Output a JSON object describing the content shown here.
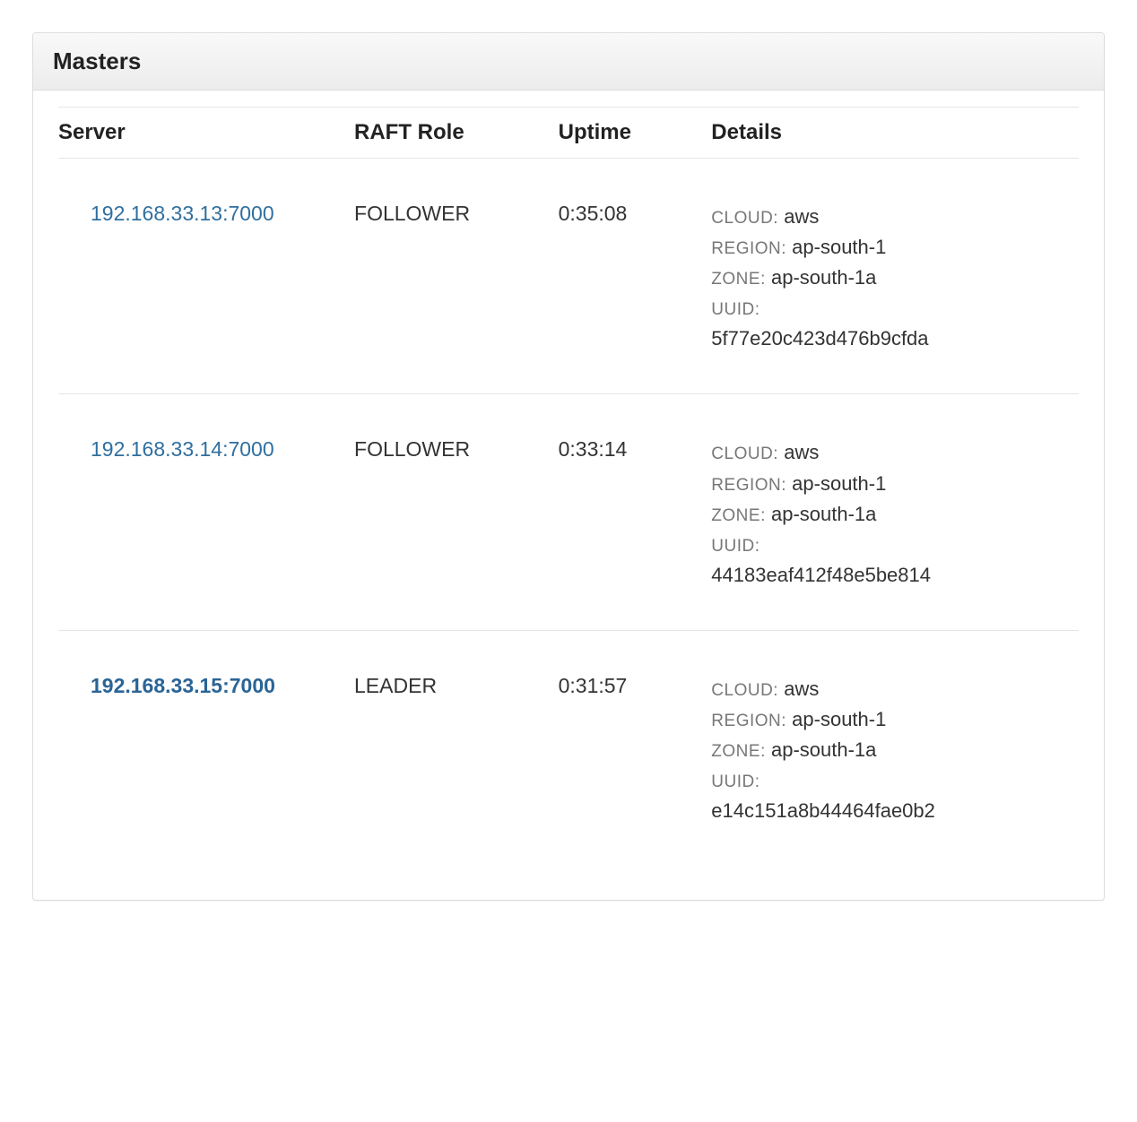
{
  "panel": {
    "title": "Masters"
  },
  "columns": {
    "server": "Server",
    "role": "RAFT Role",
    "uptime": "Uptime",
    "details": "Details"
  },
  "labels": {
    "cloud": "CLOUD:",
    "region": "REGION:",
    "zone": "ZONE:",
    "uuid": "UUID:"
  },
  "rows": [
    {
      "server": "192.168.33.13:7000",
      "role": "FOLLOWER",
      "uptime": "0:35:08",
      "cloud": "aws",
      "region": "ap-south-1",
      "zone": "ap-south-1a",
      "uuid": "5f77e20c423d476b9cfda"
    },
    {
      "server": "192.168.33.14:7000",
      "role": "FOLLOWER",
      "uptime": "0:33:14",
      "cloud": "aws",
      "region": "ap-south-1",
      "zone": "ap-south-1a",
      "uuid": "44183eaf412f48e5be814"
    },
    {
      "server": "192.168.33.15:7000",
      "role": "LEADER",
      "uptime": "0:31:57",
      "cloud": "aws",
      "region": "ap-south-1",
      "zone": "ap-south-1a",
      "uuid": "e14c151a8b44464fae0b2"
    }
  ]
}
